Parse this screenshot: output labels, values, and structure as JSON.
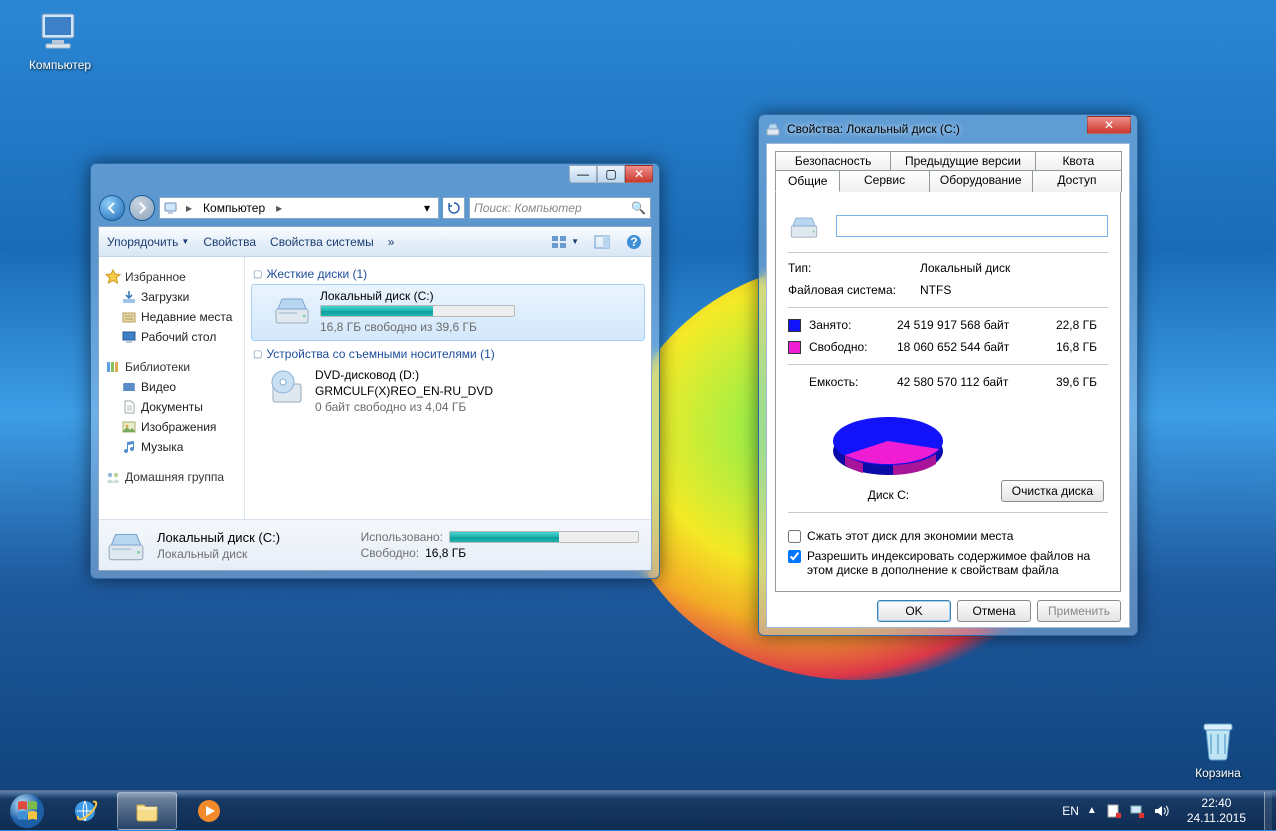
{
  "desktop": {
    "computer_label": "Компьютер",
    "recycle_label": "Корзина"
  },
  "explorer": {
    "breadcrumb_root": "Компьютер",
    "search_placeholder": "Поиск: Компьютер",
    "toolbar": {
      "organize": "Упорядочить",
      "properties": "Свойства",
      "system_properties": "Свойства системы"
    },
    "nav": {
      "favorites": "Избранное",
      "downloads": "Загрузки",
      "recent": "Недавние места",
      "desktop": "Рабочий стол",
      "libraries": "Библиотеки",
      "video": "Видео",
      "documents": "Документы",
      "pictures": "Изображения",
      "music": "Музыка",
      "homegroup": "Домашняя группа"
    },
    "categories": {
      "hard_drives": "Жесткие диски (1)",
      "removable": "Устройства со съемными носителями (1)"
    },
    "drive_c": {
      "name": "Локальный диск (C:)",
      "free_text": "16,8 ГБ свободно из 39,6 ГБ",
      "fill_percent": 58
    },
    "drive_d": {
      "name": "DVD-дисковод (D:)",
      "label": "GRMCULF(X)REO_EN-RU_DVD",
      "free_text": "0 байт свободно из 4,04 ГБ"
    },
    "details": {
      "title": "Локальный диск (C:)",
      "subtitle": "Локальный диск",
      "used_label": "Использовано:",
      "free_label": "Свободно:",
      "free_value": "16,8 ГБ",
      "fill_percent": 58
    }
  },
  "props": {
    "title": "Свойства: Локальный диск (C:)",
    "tabs_row1": {
      "security": "Безопасность",
      "previous": "Предыдущие версии",
      "quota": "Квота"
    },
    "tabs_row2": {
      "general": "Общие",
      "service": "Сервис",
      "hardware": "Оборудование",
      "access": "Доступ"
    },
    "name_value": "",
    "type_label": "Тип:",
    "type_value": "Локальный диск",
    "fs_label": "Файловая система:",
    "fs_value": "NTFS",
    "used_label": "Занято:",
    "used_bytes": "24 519 917 568 байт",
    "used_h": "22,8 ГБ",
    "free_label": "Свободно:",
    "free_bytes": "18 060 652 544 байт",
    "free_h": "16,8 ГБ",
    "cap_label": "Емкость:",
    "cap_bytes": "42 580 570 112 байт",
    "cap_h": "39,6 ГБ",
    "pie_label": "Диск C:",
    "cleanup_btn": "Очистка диска",
    "chk_compress": "Сжать этот диск для экономии места",
    "chk_index": "Разрешить индексировать содержимое файлов на этом диске в дополнение к свойствам файла",
    "ok": "OK",
    "cancel": "Отмена",
    "apply": "Применить"
  },
  "taskbar": {
    "lang": "EN",
    "time": "22:40",
    "date": "24.11.2015"
  },
  "chart_data": {
    "type": "pie",
    "title": "Диск C:",
    "series": [
      {
        "name": "Занято",
        "value": 24519917568,
        "human": "22,8 ГБ",
        "color": "#1313f9"
      },
      {
        "name": "Свободно",
        "value": 18060652544,
        "human": "16,8 ГБ",
        "color": "#ef1ed4"
      }
    ],
    "capacity": {
      "bytes": 42580570112,
      "human": "39,6 ГБ"
    }
  }
}
